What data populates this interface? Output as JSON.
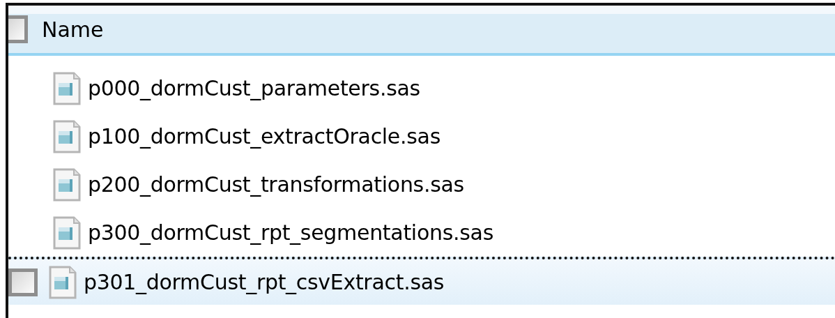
{
  "header": {
    "label": "Name",
    "checked": false
  },
  "rows": [
    {
      "name": "p000_dormCust_parameters.sas",
      "hot": false,
      "focused": false
    },
    {
      "name": "p100_dormCust_extractOracle.sas",
      "hot": false,
      "focused": false
    },
    {
      "name": "p200_dormCust_transformations.sas",
      "hot": false,
      "focused": false
    },
    {
      "name": "p300_dormCust_rpt_segmentations.sas",
      "hot": false,
      "focused": false
    },
    {
      "name": "p301_dormCust_rpt_csvExtract.sas",
      "hot": true,
      "focused": true
    }
  ]
}
